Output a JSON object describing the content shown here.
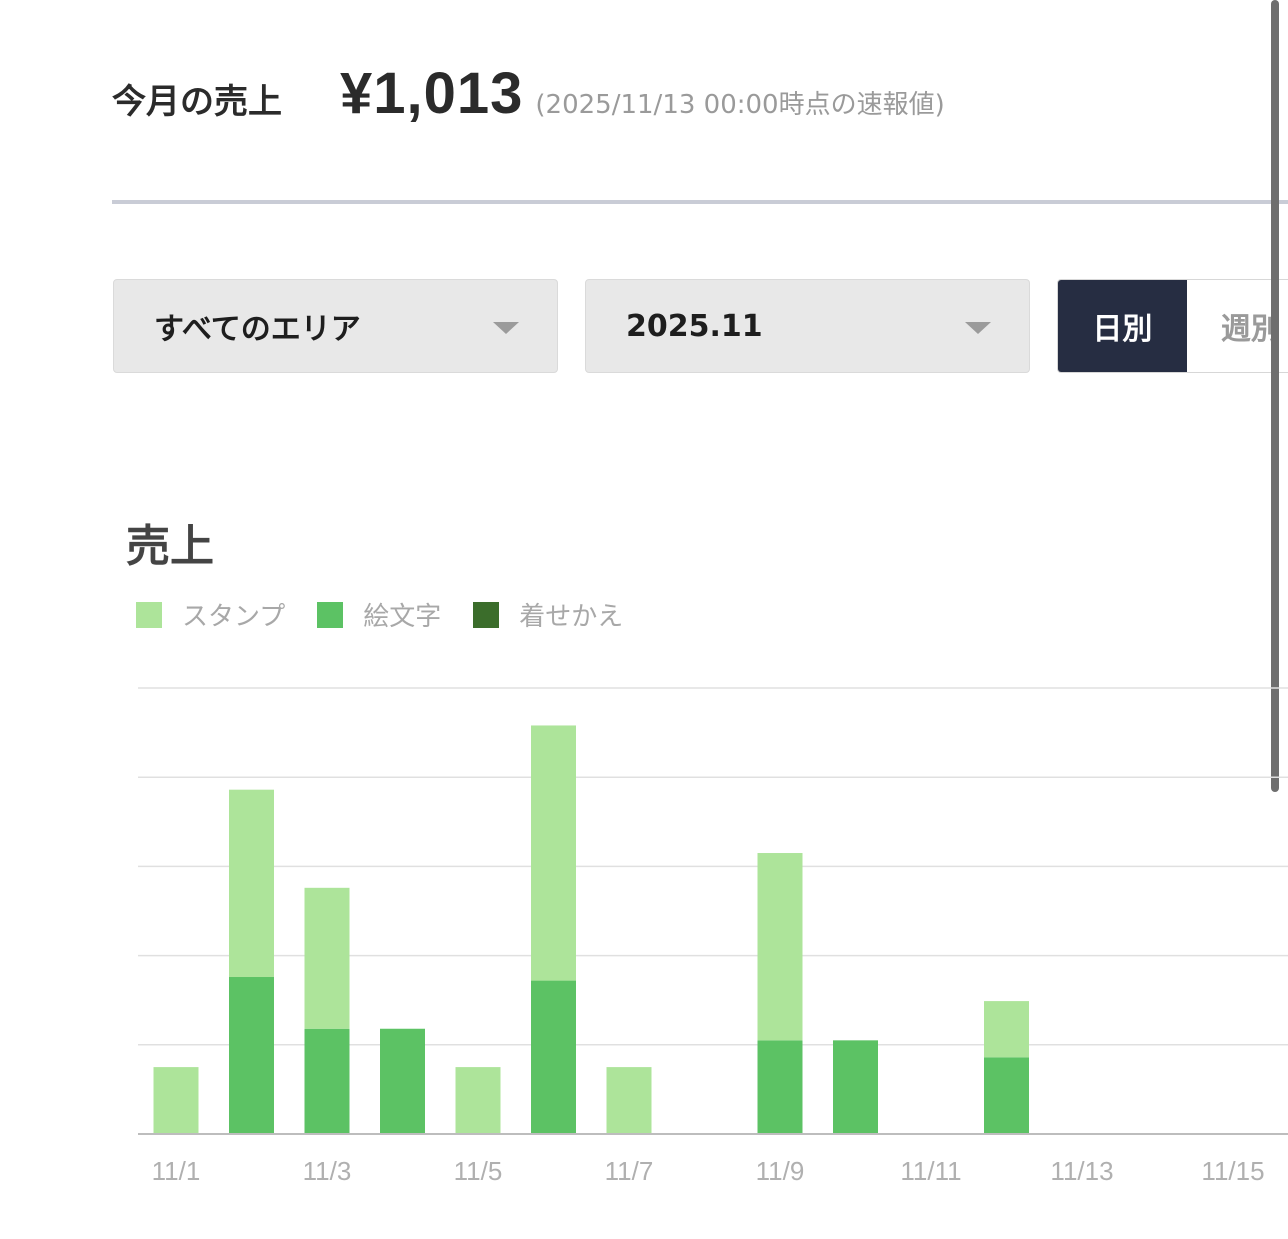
{
  "summary": {
    "label": "今月の売上",
    "amount": "¥1,013",
    "note": "(2025/11/13 00:00時点の速報値)"
  },
  "filters": {
    "area": "すべてのエリア",
    "month": "2025.11"
  },
  "period_toggle": {
    "daily": "日別",
    "weekly": "週別",
    "selected": "日別"
  },
  "chart_data": {
    "type": "bar",
    "stacked": true,
    "title": "売上",
    "legend_position": "top-left",
    "grid": true,
    "ylim": [
      0,
      5
    ],
    "x": [
      "11/1",
      "11/2",
      "11/3",
      "11/4",
      "11/5",
      "11/6",
      "11/7",
      "11/8",
      "11/9",
      "11/10",
      "11/11",
      "11/12",
      "11/13",
      "11/14",
      "11/15"
    ],
    "x_tick_labels": [
      "11/1",
      "11/3",
      "11/5",
      "11/7",
      "11/9",
      "11/11",
      "11/13",
      "11/15"
    ],
    "series": [
      {
        "name": "スタンプ",
        "color": "#ade49a",
        "values": [
          0.75,
          2.1,
          1.58,
          0,
          0.75,
          2.86,
          0.75,
          0,
          2.1,
          0,
          0,
          0.63,
          0,
          0,
          0
        ]
      },
      {
        "name": "絵文字",
        "color": "#5cc264",
        "values": [
          0,
          1.76,
          1.18,
          1.18,
          0,
          1.72,
          0,
          0,
          1.05,
          1.05,
          0,
          0.86,
          0,
          0,
          0
        ]
      },
      {
        "name": "着せかえ",
        "color": "#3b6d2b",
        "values": [
          0,
          0,
          0,
          0,
          0,
          0,
          0,
          0,
          0,
          0,
          0,
          0,
          0,
          0,
          0
        ]
      }
    ]
  }
}
